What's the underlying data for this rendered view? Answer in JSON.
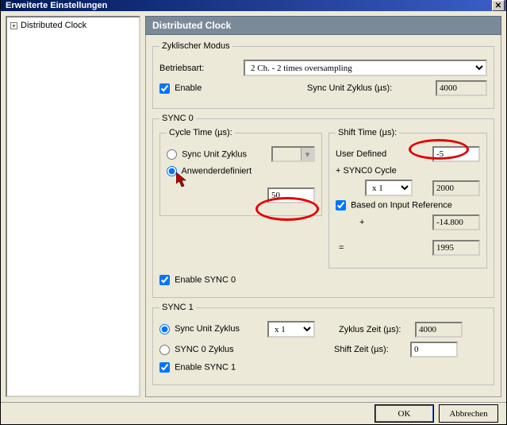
{
  "window": {
    "title": "Erweiterte Einstellungen"
  },
  "tree": {
    "item": "Distributed Clock",
    "expander": "+"
  },
  "header": "Distributed Clock",
  "cyclic": {
    "legend": "Zyklischer Modus",
    "betriebsart_label": "Betriebsart:",
    "betriebsart_value": "2 Ch. - 2 times oversampling",
    "enable_label": "Enable",
    "sync_unit_label": "Sync Unit Zyklus (µs):",
    "sync_unit_value": "4000"
  },
  "sync0": {
    "legend": "SYNC 0",
    "cycle": {
      "legend": "Cycle Time (µs):",
      "radio_sync_unit": "Sync Unit Zyklus",
      "radio_user": "Anwenderdefiniert",
      "value": "50"
    },
    "shift": {
      "legend": "Shift Time (µs):",
      "user_defined_label": "User Defined",
      "user_defined_value": "-5",
      "plus_sync0_label": "+ SYNC0 Cycle",
      "mult_value": "x 1",
      "mult_result": "2000",
      "based_label": "Based on Input Reference",
      "plus_label": "+",
      "plus_value": "-14.800",
      "eq_label": "=",
      "eq_value": "1995"
    },
    "enable_label": "Enable SYNC 0"
  },
  "sync1": {
    "legend": "SYNC 1",
    "radio_sync_unit": "Sync Unit Zyklus",
    "radio_sync0": "SYNC 0 Zyklus",
    "mult_value": "x 1",
    "zyklus_label": "Zyklus Zeit (µs):",
    "zyklus_value": "4000",
    "shift_label": "Shift Zeit (µs):",
    "shift_value": "0",
    "enable_label": "Enable SYNC 1"
  },
  "buttons": {
    "ok": "OK",
    "cancel": "Abbrechen"
  },
  "icons": {
    "close": "✕",
    "dropdown": "▾"
  }
}
